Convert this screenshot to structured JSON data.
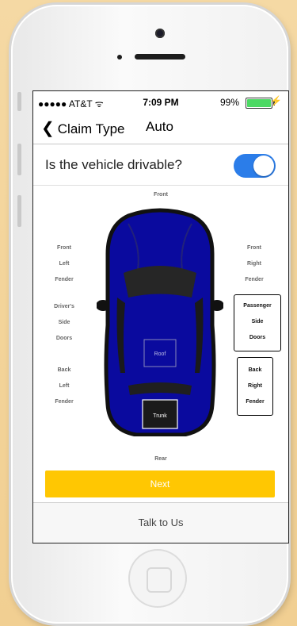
{
  "status_bar": {
    "carrier": "●●●●● AT&T ᯤ",
    "time": "7:09 PM",
    "battery_pct": "99%",
    "battery_level": 0.99
  },
  "nav": {
    "back_label": "Claim Type",
    "title": "Auto"
  },
  "drivable": {
    "question": "Is the vehicle drivable?",
    "toggle_on": true
  },
  "zones": {
    "front": "Front",
    "rear": "Rear",
    "front_left": [
      "Front",
      "Left",
      "Fender"
    ],
    "front_right": [
      "Front",
      "Right",
      "Fender"
    ],
    "driver_side": [
      "Driver's",
      "Side",
      "Doors"
    ],
    "passenger_side": [
      "Passenger",
      "Side",
      "Doors"
    ],
    "back_left": [
      "Back",
      "Left",
      "Fender"
    ],
    "back_right": [
      "Back",
      "Right",
      "Fender"
    ],
    "roof": "Roof",
    "trunk": "Trunk"
  },
  "actions": {
    "next": "Next",
    "talk": "Talk to Us"
  },
  "colors": {
    "car_body": "#0a0a9e",
    "toggle": "#2b7de9",
    "next_button": "#ffc702"
  }
}
